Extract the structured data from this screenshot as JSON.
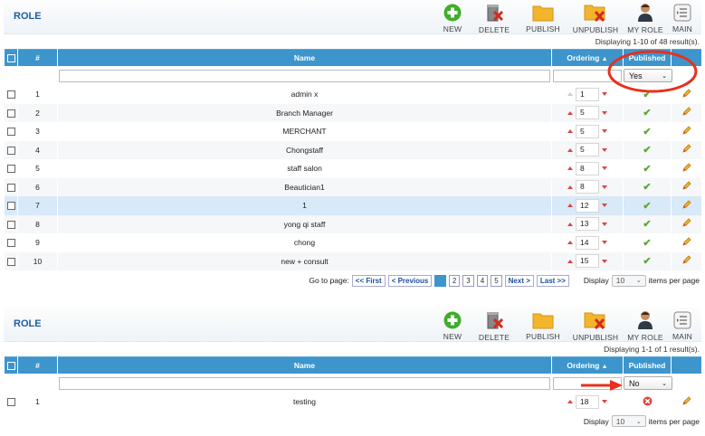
{
  "toolbar": {
    "new": "NEW",
    "delete": "DELETE",
    "publish": "PUBLISH",
    "unpublish": "UNPUBLISH",
    "my_role": "MY ROLE",
    "main": "MAIN"
  },
  "colors": {
    "header_blue": "#3d95cc",
    "title_blue": "#1c5fa4",
    "annotation_red": "#e8301c"
  },
  "panel1": {
    "title": "ROLE",
    "displaying": "Displaying 1-10 of 48 result(s).",
    "columns": {
      "num": "#",
      "name": "Name",
      "ordering": "Ordering",
      "published": "Published"
    },
    "filter_published": "Yes",
    "rows": [
      {
        "num": "1",
        "name": "admin x",
        "order": "1"
      },
      {
        "num": "2",
        "name": "Branch Manager",
        "order": "5"
      },
      {
        "num": "3",
        "name": "MERCHANT",
        "order": "5"
      },
      {
        "num": "4",
        "name": "Chongstaff",
        "order": "5"
      },
      {
        "num": "5",
        "name": "staff salon",
        "order": "8"
      },
      {
        "num": "6",
        "name": "Beautician1",
        "order": "8"
      },
      {
        "num": "7",
        "name": "1",
        "order": "12"
      },
      {
        "num": "8",
        "name": "yong qi staff",
        "order": "13"
      },
      {
        "num": "9",
        "name": "chong",
        "order": "14"
      },
      {
        "num": "10",
        "name": "new + consult",
        "order": "15"
      }
    ],
    "pager": {
      "goto": "Go to page:",
      "first": "<< First",
      "prev": "< Previous",
      "pages": [
        "1",
        "2",
        "3",
        "4",
        "5"
      ],
      "next": "Next >",
      "last": "Last >>",
      "display": "Display",
      "per_page": "10",
      "items_per_page": "items per page"
    }
  },
  "panel2": {
    "title": "ROLE",
    "displaying": "Displaying 1-1 of 1 result(s).",
    "columns": {
      "num": "#",
      "name": "Name",
      "ordering": "Ordering",
      "published": "Published"
    },
    "filter_published": "No",
    "rows": [
      {
        "num": "1",
        "name": "testing",
        "order": "18"
      }
    ],
    "pager": {
      "display": "Display",
      "per_page": "10",
      "items_per_page": "items per page"
    }
  }
}
